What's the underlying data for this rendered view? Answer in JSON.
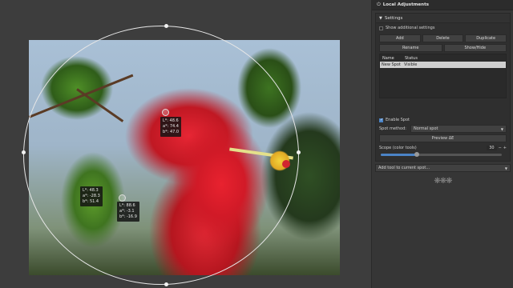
{
  "panel": {
    "title": "Local Adjustments",
    "settings_title": "Settings",
    "show_additional": "Show additional settings",
    "buttons": {
      "add": "Add",
      "delete": "Delete",
      "duplicate": "Duplicate",
      "rename": "Rename",
      "show_hide": "Show/Hide"
    },
    "table": {
      "col_name": "Name",
      "col_status": "Status",
      "rows": [
        {
          "name": "New Spot",
          "status": "Visible"
        }
      ]
    },
    "enable_spot": "Enable Spot",
    "spot_method_label": "Spot method:",
    "spot_method_value": "Normal spot",
    "preview": "Preview ΔE",
    "scope_label": "Scope (color tools)",
    "scope_value": "30",
    "scope_level": 0.3,
    "add_tool": "Add tool to current spot..."
  },
  "probes": [
    {
      "l": "L*: 48.6",
      "a": "a*: 74.4",
      "b": "b*: 47.0"
    },
    {
      "l": "L*: 48.3",
      "a": "a*: -28.3",
      "b": "b*: 51.4"
    },
    {
      "l": "L*: 88.6",
      "a": "a*: -3.1",
      "b": "b*: -16.9"
    }
  ],
  "colors": {
    "accent": "#4b84c7",
    "flower_red": "#e02a35",
    "leaf_green": "#4f8f27"
  }
}
